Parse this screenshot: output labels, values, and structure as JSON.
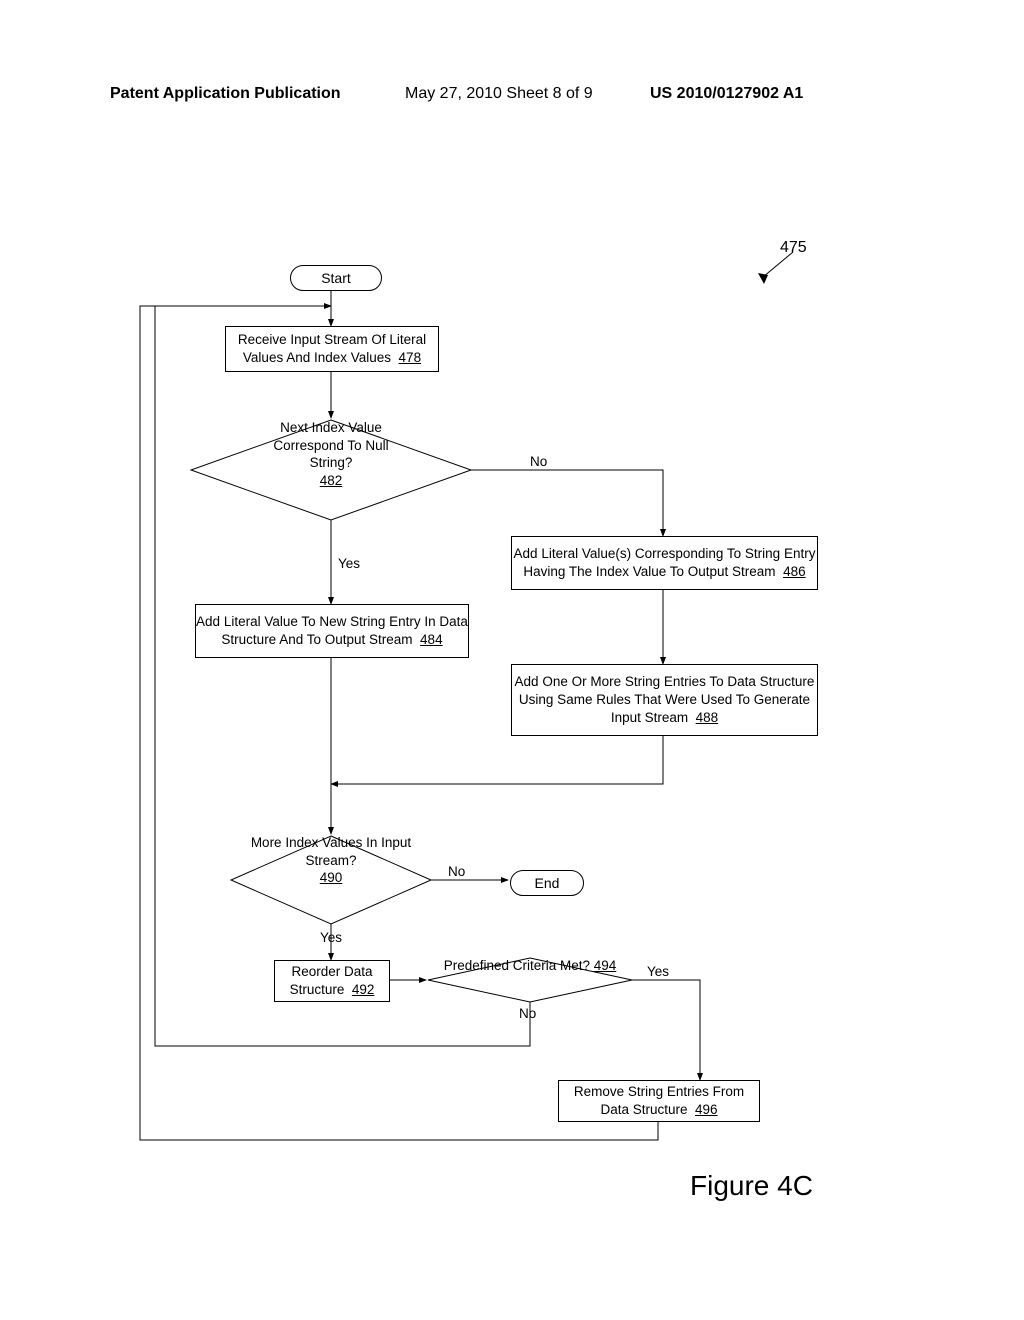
{
  "header": {
    "left": "Patent Application Publication",
    "mid": "May 27, 2010  Sheet 8 of 9",
    "right": "US 2010/0127902 A1"
  },
  "figure_label": "Figure 4C",
  "ref_overall": "475",
  "terminals": {
    "start": "Start",
    "end": "End"
  },
  "boxes": {
    "b478": {
      "text": "Receive Input Stream Of Literal Values And Index Values",
      "ref": "478"
    },
    "b484": {
      "text": "Add Literal Value To New String Entry In Data Structure And To Output Stream",
      "ref": "484"
    },
    "b486": {
      "text": "Add Literal Value(s) Corresponding To String Entry Having The Index Value To Output Stream",
      "ref": "486"
    },
    "b488": {
      "text": "Add One Or More String Entries To Data Structure Using Same Rules That Were Used To Generate Input Stream",
      "ref": "488"
    },
    "b492": {
      "text": "Reorder Data Structure",
      "ref": "492"
    },
    "b496": {
      "text": "Remove String Entries From Data Structure",
      "ref": "496"
    }
  },
  "decisions": {
    "d482": {
      "text": "Next Index Value Correspond To Null String?",
      "ref": "482"
    },
    "d490": {
      "text": "More Index Values In Input Stream?",
      "ref": "490"
    },
    "d494": {
      "text": "Predefined Criteria Met?",
      "ref": "494"
    }
  },
  "edges": {
    "yes1": "Yes",
    "no1": "No",
    "yes2": "Yes",
    "no2": "No",
    "yes3": "Yes",
    "no3": "No"
  }
}
